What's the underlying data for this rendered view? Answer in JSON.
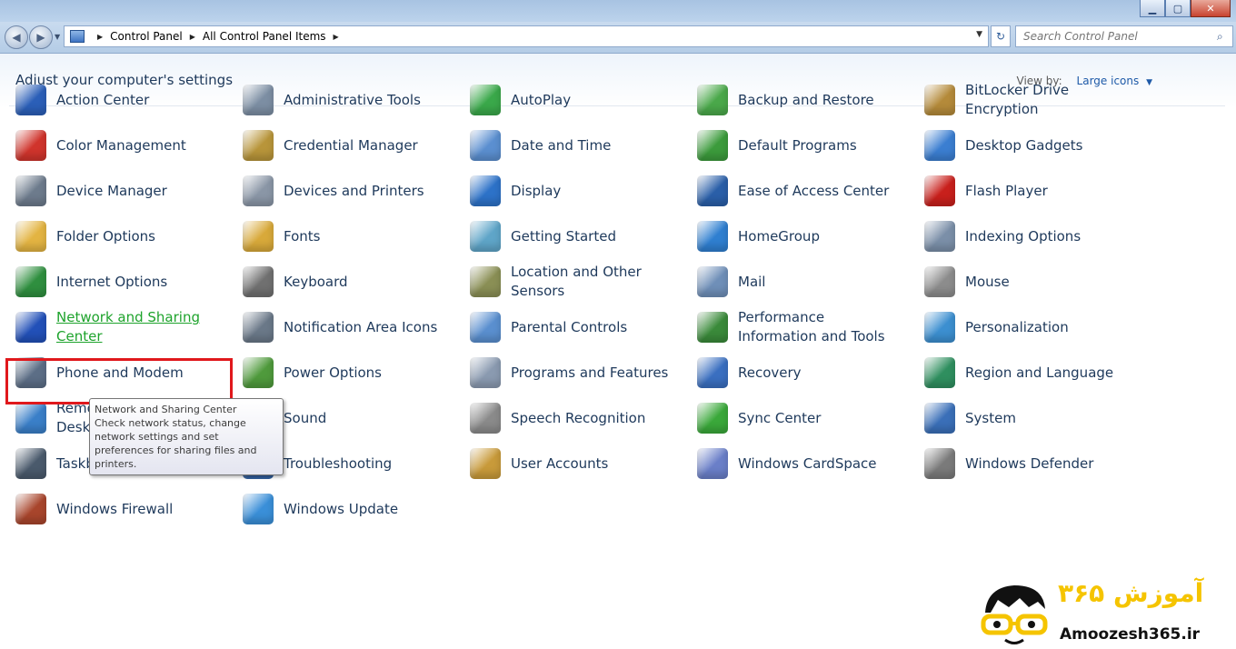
{
  "address": {
    "crumbs": [
      "Control Panel",
      "All Control Panel Items"
    ]
  },
  "search": {
    "placeholder": "Search Control Panel"
  },
  "header": {
    "title": "Adjust your computer's settings",
    "view_by_label": "View by:",
    "view_by_value": "Large icons"
  },
  "items": [
    {
      "label": "Action Center",
      "icon": "flag-icon",
      "color": "#2b5fb8"
    },
    {
      "label": "Administrative Tools",
      "icon": "admin-tools-icon",
      "color": "#7c8ea3"
    },
    {
      "label": "AutoPlay",
      "icon": "autoplay-icon",
      "color": "#3aa84a"
    },
    {
      "label": "Backup and Restore",
      "icon": "backup-icon",
      "color": "#4aa84a"
    },
    {
      "label": "BitLocker Drive Encryption",
      "icon": "bitlocker-icon",
      "color": "#b48a3a"
    },
    {
      "label": "Color Management",
      "icon": "color-management-icon",
      "color": "#d0342c"
    },
    {
      "label": "Credential Manager",
      "icon": "credential-icon",
      "color": "#b8953a"
    },
    {
      "label": "Date and Time",
      "icon": "calendar-clock-icon",
      "color": "#5b8fd0"
    },
    {
      "label": "Default Programs",
      "icon": "default-programs-icon",
      "color": "#3c9b3c"
    },
    {
      "label": "Desktop Gadgets",
      "icon": "gadgets-icon",
      "color": "#3b7ed1"
    },
    {
      "label": "Device Manager",
      "icon": "device-manager-icon",
      "color": "#6d7b8c"
    },
    {
      "label": "Devices and Printers",
      "icon": "printer-icon",
      "color": "#8a96a6"
    },
    {
      "label": "Display",
      "icon": "monitor-icon",
      "color": "#2d72c8"
    },
    {
      "label": "Ease of Access Center",
      "icon": "ease-of-access-icon",
      "color": "#2a5fa8"
    },
    {
      "label": "Flash Player",
      "icon": "flash-icon",
      "color": "#c8201c"
    },
    {
      "label": "Folder Options",
      "icon": "folder-icon",
      "color": "#e3b442"
    },
    {
      "label": "Fonts",
      "icon": "fonts-icon",
      "color": "#d8a93a"
    },
    {
      "label": "Getting Started",
      "icon": "getting-started-icon",
      "color": "#5fa5c8"
    },
    {
      "label": "HomeGroup",
      "icon": "homegroup-icon",
      "color": "#2f7fd0"
    },
    {
      "label": "Indexing Options",
      "icon": "indexing-icon",
      "color": "#7b8fa8"
    },
    {
      "label": "Internet Options",
      "icon": "globe-icon",
      "color": "#2f8f3f"
    },
    {
      "label": "Keyboard",
      "icon": "keyboard-icon",
      "color": "#707070"
    },
    {
      "label": "Location and Other Sensors",
      "icon": "location-icon",
      "color": "#8a8f55"
    },
    {
      "label": "Mail",
      "icon": "mail-icon",
      "color": "#6f8fb8"
    },
    {
      "label": "Mouse",
      "icon": "mouse-icon",
      "color": "#8c8c8c"
    },
    {
      "label": "Network and Sharing Center",
      "icon": "network-icon",
      "color": "#2250b8",
      "highlight": true
    },
    {
      "label": "Notification Area Icons",
      "icon": "notification-icon",
      "color": "#6a7888"
    },
    {
      "label": "Parental Controls",
      "icon": "parental-controls-icon",
      "color": "#5a8fcf"
    },
    {
      "label": "Performance Information and Tools",
      "icon": "performance-icon",
      "color": "#3a8a3a"
    },
    {
      "label": "Personalization",
      "icon": "personalization-icon",
      "color": "#3c8fd0"
    },
    {
      "label": "Phone and Modem",
      "icon": "phone-icon",
      "color": "#5c6e86"
    },
    {
      "label": "Power Options",
      "icon": "power-icon",
      "color": "#4f9a3c"
    },
    {
      "label": "Programs and Features",
      "icon": "programs-icon",
      "color": "#8a9ab0"
    },
    {
      "label": "Recovery",
      "icon": "recovery-icon",
      "color": "#3a6fc0"
    },
    {
      "label": "Region and Language",
      "icon": "region-icon",
      "color": "#2f8f5f"
    },
    {
      "label": "RemoteApp and Desktop Connections",
      "icon": "remoteapp-icon",
      "color": "#3a7fc8"
    },
    {
      "label": "Sound",
      "icon": "speaker-icon",
      "color": "#8c8c8c"
    },
    {
      "label": "Speech Recognition",
      "icon": "microphone-icon",
      "color": "#8a8a8a"
    },
    {
      "label": "Sync Center",
      "icon": "sync-icon",
      "color": "#3aa83a"
    },
    {
      "label": "System",
      "icon": "system-icon",
      "color": "#3a6fb8"
    },
    {
      "label": "Taskbar and Start Menu",
      "icon": "taskbar-icon",
      "color": "#4a5a6c"
    },
    {
      "label": "Troubleshooting",
      "icon": "troubleshooting-icon",
      "color": "#3a6fb8"
    },
    {
      "label": "User Accounts",
      "icon": "user-accounts-icon",
      "color": "#c89a3a"
    },
    {
      "label": "Windows CardSpace",
      "icon": "cardspace-icon",
      "color": "#6a7fc8"
    },
    {
      "label": "Windows Defender",
      "icon": "defender-icon",
      "color": "#7a7a7a"
    },
    {
      "label": "Windows Firewall",
      "icon": "firewall-icon",
      "color": "#a8452c"
    },
    {
      "label": "Windows Update",
      "icon": "windows-update-icon",
      "color": "#3a8fd8"
    }
  ],
  "tooltip": {
    "title": "Network and Sharing Center",
    "body": "Check network status, change network settings and set preferences for sharing files and printers."
  },
  "watermark": {
    "brand": "آموزش ۳۶۵",
    "site": "Amoozesh365.ir"
  }
}
